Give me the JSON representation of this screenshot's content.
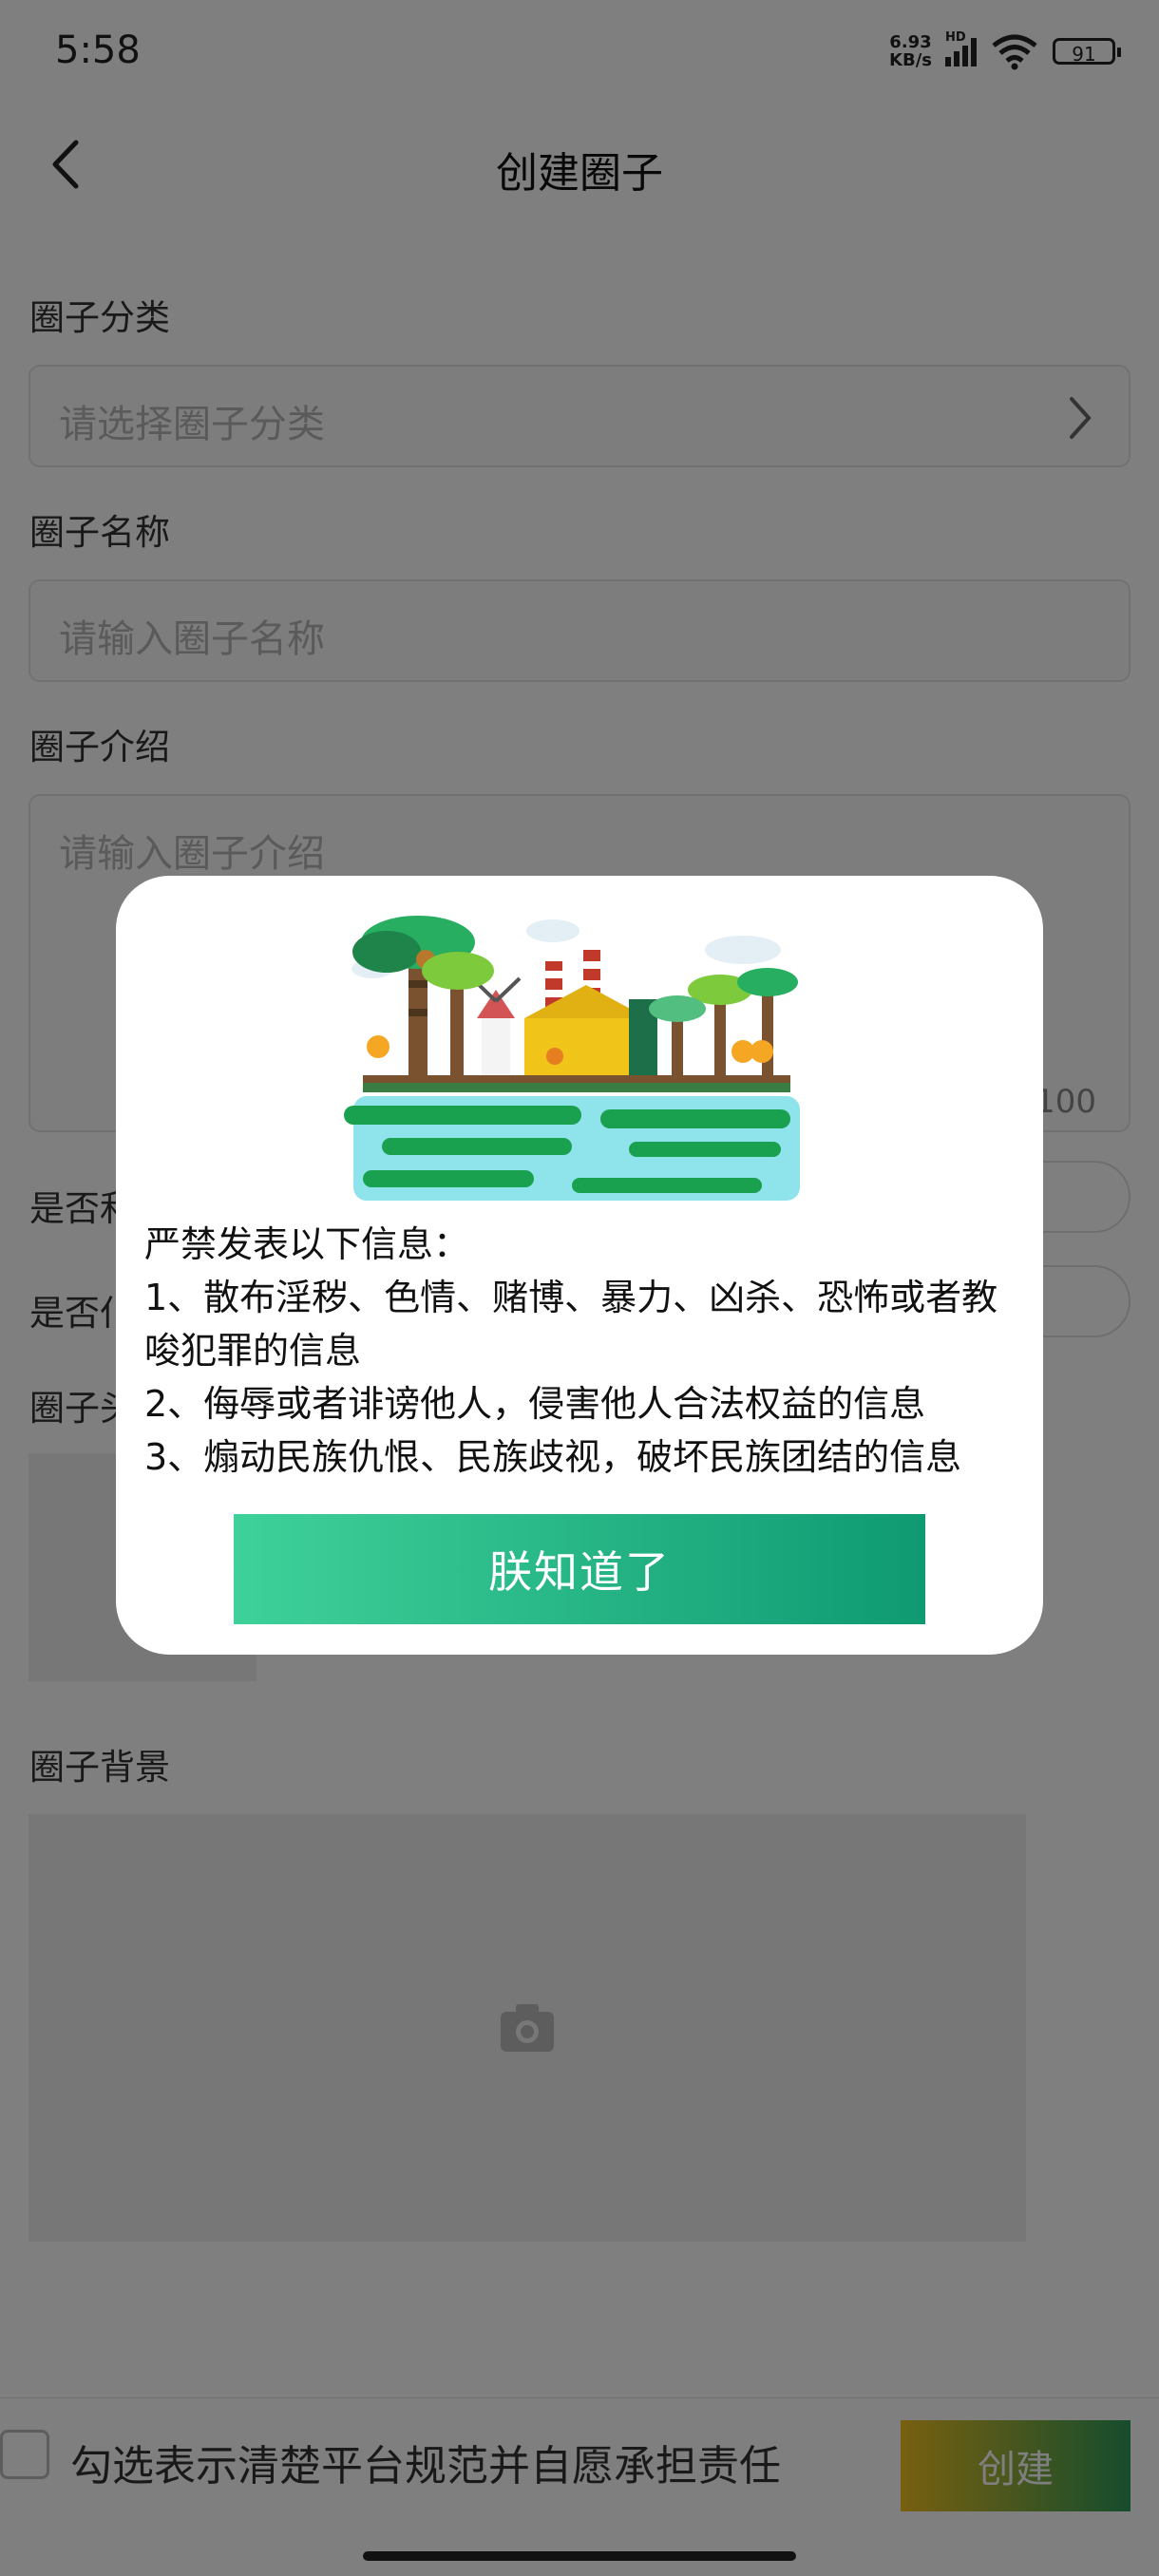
{
  "status_bar": {
    "time": "5:58",
    "net_speed_value": "6.93",
    "net_speed_unit": "KB/s",
    "hd_label": "HD",
    "battery": "91"
  },
  "header": {
    "title": "创建圈子",
    "back_icon": "chevron-left-icon"
  },
  "form": {
    "category_label": "圈子分类",
    "category_placeholder": "请选择圈子分类",
    "name_label": "圈子名称",
    "name_placeholder": "请输入圈子名称",
    "intro_label": "圈子介绍",
    "intro_placeholder": "请输入圈子介绍",
    "intro_counter": "/100",
    "option1_label_partial": "是否和",
    "option2_label_partial": "是否仆",
    "avatar_label_partial": "圈子头",
    "background_label": "圈子背景",
    "camera_icon": "camera-icon"
  },
  "bottom": {
    "agree_text": "勾选表示清楚平台规范并自愿承担责任",
    "create_label": "创建"
  },
  "dialog": {
    "notice_title": "严禁发表以下信息：",
    "rules": [
      "1、散布淫秽、色情、赌博、暴力、凶杀、恐怖或者教唆犯罪的信息",
      "2、侮辱或者诽谤他人，侵害他人合法权益的信息",
      "3、煽动民族仇恨、民族歧视，破坏民族团结的信息"
    ],
    "confirm_label": "朕知道了"
  },
  "colors": {
    "accent_green": "#1fa57a",
    "overlay": "rgba(0,0,0,0.5)"
  }
}
